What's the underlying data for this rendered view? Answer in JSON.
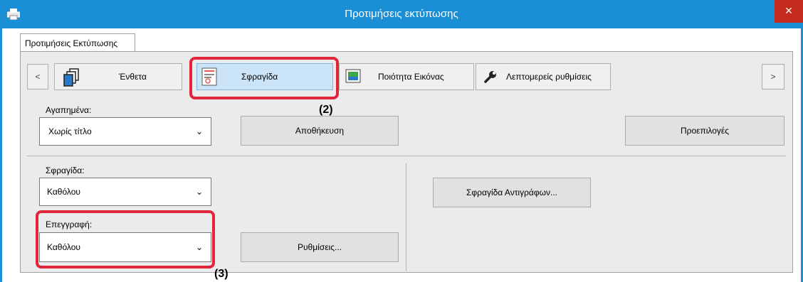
{
  "window": {
    "title": "Προτιμήσεις εκτύπωσης",
    "close_glyph": "×",
    "app_icon": "printer-icon"
  },
  "tab": {
    "label": "Προτιμήσεις Εκτύπωσης"
  },
  "toolbar": {
    "prev": "<",
    "next": ">",
    "items": [
      {
        "label": "Ένθετα",
        "icon": "pages-icon"
      },
      {
        "label": "Σφραγίδα",
        "icon": "stamp-icon"
      },
      {
        "label": "Ποιότητα Εικόνας",
        "icon": "image-quality-icon"
      },
      {
        "label": "Λεπτομερείς ρυθμίσεις",
        "icon": "wrench-icon"
      }
    ]
  },
  "favorites": {
    "label": "Αγαπημένα:",
    "value": "Χωρίς τίτλο",
    "save": "Αποθήκευση",
    "defaults": "Προεπιλογές"
  },
  "stamp": {
    "label": "Σφραγίδα:",
    "value": "Καθόλου",
    "copy_stamp": "Σφραγίδα Αντιγράφων..."
  },
  "overlay": {
    "label": "Επεγγραφή:",
    "value": "Καθόλου",
    "settings": "Ρυθμίσεις..."
  },
  "callouts": {
    "c2": "(2)",
    "c3": "(3)"
  },
  "colors": {
    "titlebar": "#1b8fd6",
    "highlight": "#e1253a",
    "selected_tab": "#cce4f7"
  }
}
